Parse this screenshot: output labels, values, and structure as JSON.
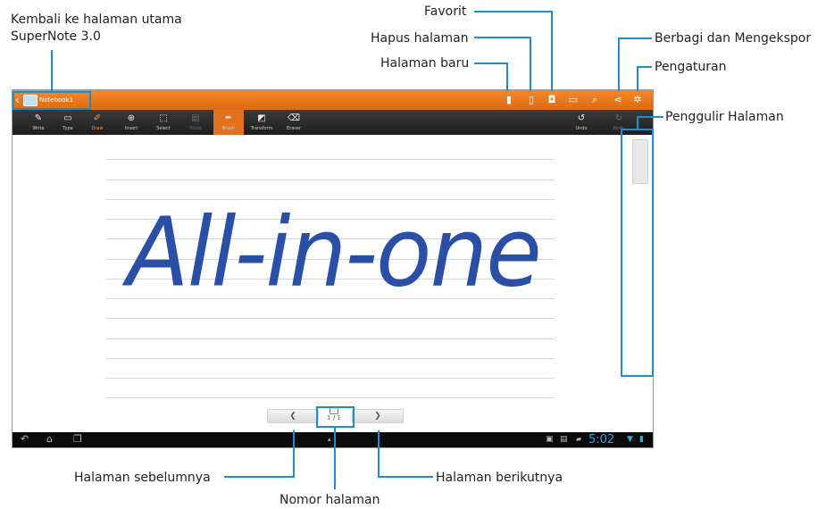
{
  "callouts": {
    "back_home": "Kembali ke halaman utama\nSuperNote 3.0",
    "favorite": "Favorit",
    "delete_page": "Hapus halaman",
    "new_page": "Halaman baru",
    "share_export": "Berbagi dan Mengekspor",
    "settings": "Pengaturan",
    "page_scroller": "Penggulir Halaman",
    "prev_page": "Halaman sebelumnya",
    "page_number": "Nomor halaman",
    "next_page": "Halaman berikutnya"
  },
  "app": {
    "notebook_title": "Notebook1",
    "handwriting": "All-in-one",
    "page_indicator": "1 / 1",
    "clock": "5:02"
  },
  "toolbar": {
    "write": "Write",
    "type": "Type",
    "draw": "Draw",
    "insert": "Insert",
    "select": "Select",
    "paste": "Paste",
    "brush": "Brush",
    "transform": "Transform",
    "eraser": "Eraser",
    "undo": "Undo",
    "redo": "Redo"
  },
  "colors": {
    "accent": "#e2701c",
    "callout_blue": "#1a8fd0",
    "ink": "#2a4fa8"
  }
}
